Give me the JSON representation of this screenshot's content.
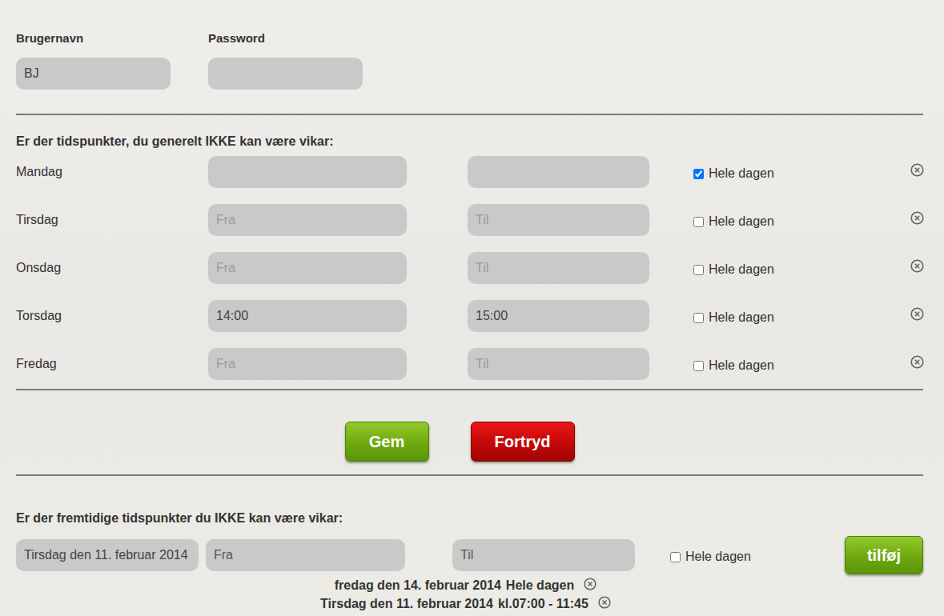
{
  "login": {
    "username_label": "Brugernavn",
    "username": "BJ",
    "password_label": "Password",
    "password": ""
  },
  "weekly": {
    "heading": "Er der tidspunkter, du generelt IKKE kan være vikar:",
    "rows": [
      {
        "day": "Mandag",
        "from": "",
        "from_placeholder": "",
        "to": "",
        "to_placeholder": "",
        "all_day_label": "Hele dagen",
        "all_day": true
      },
      {
        "day": "Tirsdag",
        "from": "",
        "from_placeholder": "Fra",
        "to": "",
        "to_placeholder": "Til",
        "all_day_label": "Hele dagen",
        "all_day": false
      },
      {
        "day": "Onsdag",
        "from": "",
        "from_placeholder": "Fra",
        "to": "",
        "to_placeholder": "Til",
        "all_day_label": "Hele dagen",
        "all_day": false
      },
      {
        "day": "Torsdag",
        "from": "14:00",
        "from_placeholder": "Fra",
        "to": "15:00",
        "to_placeholder": "Til",
        "all_day_label": "Hele dagen",
        "all_day": false
      },
      {
        "day": "Fredag",
        "from": "",
        "from_placeholder": "Fra",
        "to": "",
        "to_placeholder": "Til",
        "all_day_label": "Hele dagen",
        "all_day": false
      }
    ]
  },
  "buttons": [
    {
      "label": "Gem",
      "kind": "save"
    },
    {
      "label": "Fortryd",
      "kind": "cancel"
    }
  ],
  "future": {
    "heading": "Er der fremtidige tidspunkter du IKKE kan være vikar:",
    "date": "Tirsdag den 11. februar 2014",
    "from_placeholder": "Fra",
    "to_placeholder": "Til",
    "all_day_label": "Hele dagen",
    "all_day": false,
    "add_button": "tilføj",
    "entries": [
      {
        "date": "fredag den 14. februar 2014",
        "time": "Hele dagen"
      },
      {
        "date": "Tirsdag den 11. februar 2014",
        "time": "kl.07:00 - 11:45"
      }
    ]
  }
}
